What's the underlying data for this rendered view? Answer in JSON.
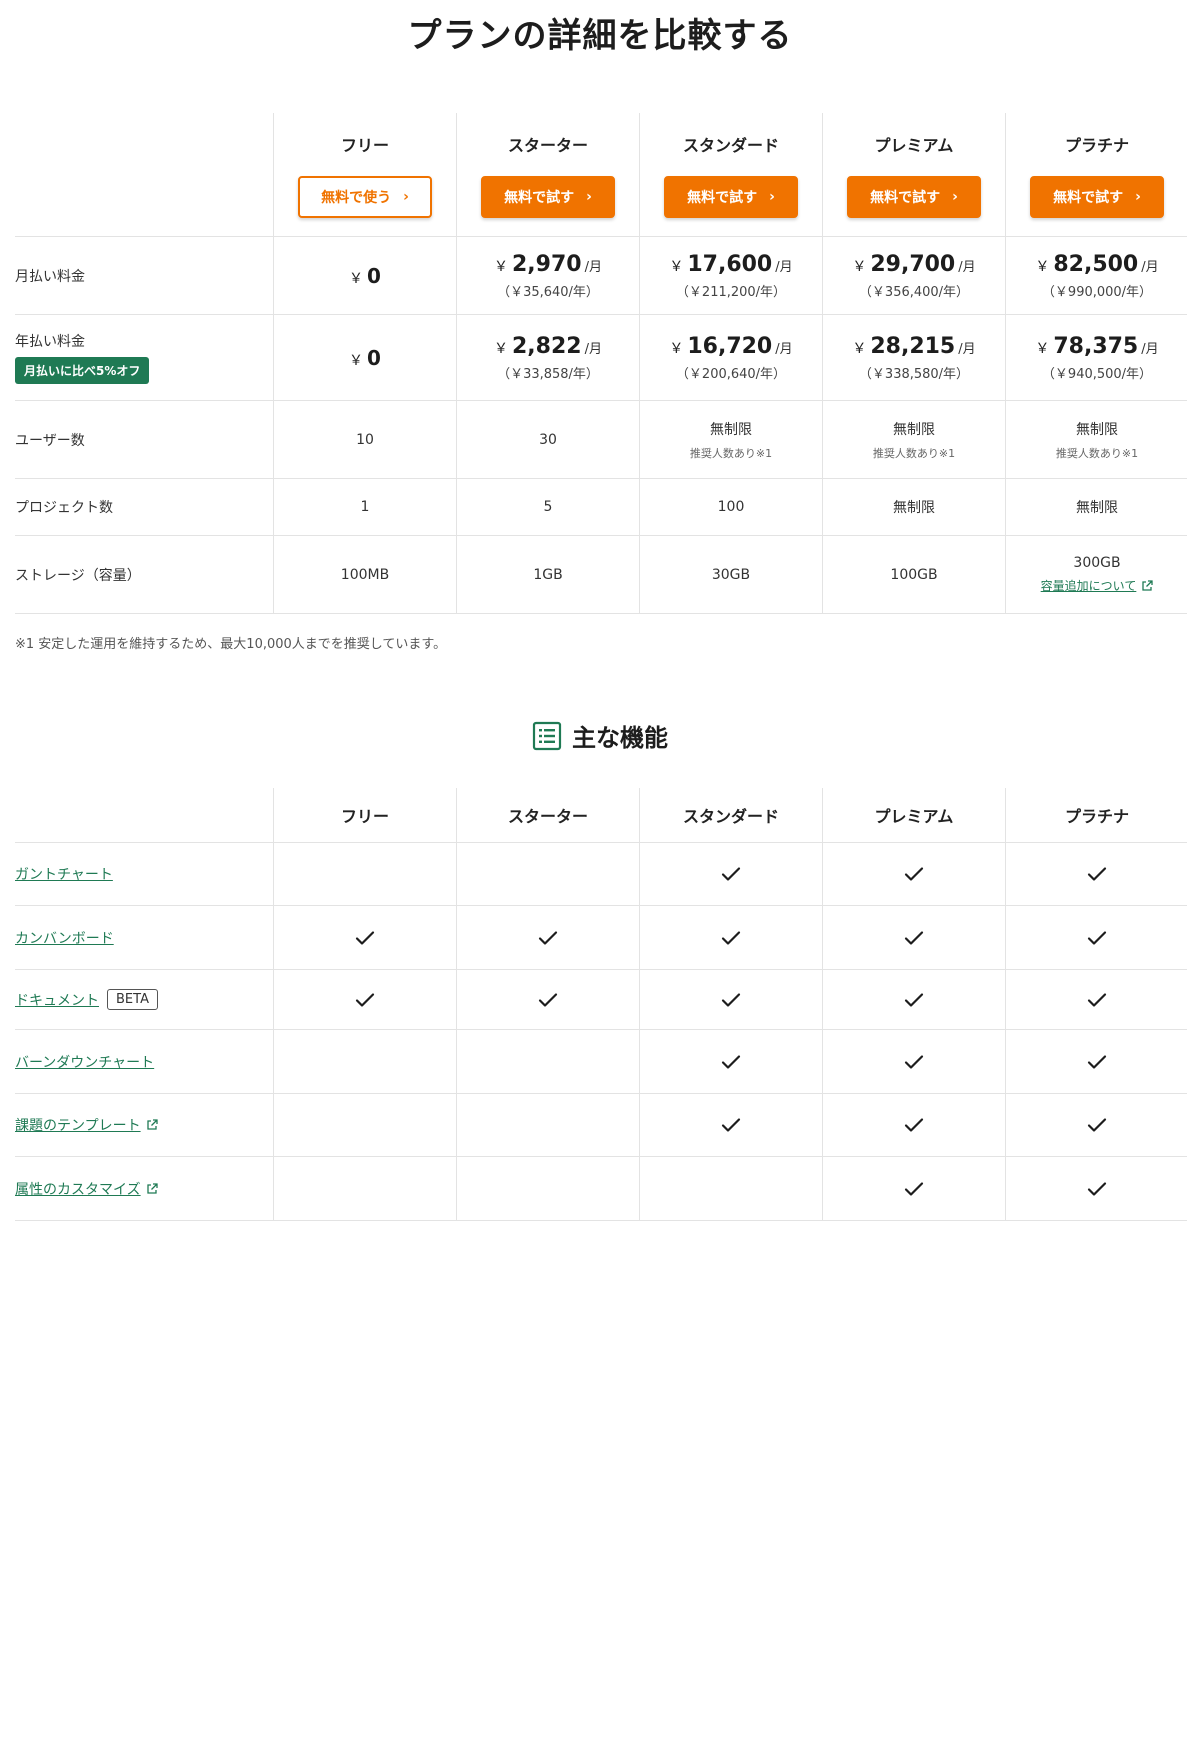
{
  "title": "プランの詳細を比較する",
  "plans": [
    {
      "name": "フリー",
      "cta": "無料で使う",
      "cta_style": "outline"
    },
    {
      "name": "スターター",
      "cta": "無料で試す",
      "cta_style": "filled"
    },
    {
      "name": "スタンダード",
      "cta": "無料で試す",
      "cta_style": "filled"
    },
    {
      "name": "プレミアム",
      "cta": "無料で試す",
      "cta_style": "filled"
    },
    {
      "name": "プラチナ",
      "cta": "無料で試す",
      "cta_style": "filled"
    }
  ],
  "currency": "￥",
  "per_month": "/月",
  "monthly": {
    "label": "月払い料金",
    "prices": [
      {
        "amount": "0",
        "yearly": ""
      },
      {
        "amount": "2,970",
        "yearly": "（￥35,640/年）"
      },
      {
        "amount": "17,600",
        "yearly": "（￥211,200/年）"
      },
      {
        "amount": "29,700",
        "yearly": "（￥356,400/年）"
      },
      {
        "amount": "82,500",
        "yearly": "（￥990,000/年）"
      }
    ]
  },
  "annual": {
    "label": "年払い料金",
    "badge": "月払いに比べ5%オフ",
    "prices": [
      {
        "amount": "0",
        "yearly": ""
      },
      {
        "amount": "2,822",
        "yearly": "（￥33,858/年）"
      },
      {
        "amount": "16,720",
        "yearly": "（￥200,640/年）"
      },
      {
        "amount": "28,215",
        "yearly": "（￥338,580/年）"
      },
      {
        "amount": "78,375",
        "yearly": "（￥940,500/年）"
      }
    ]
  },
  "users": {
    "label": "ユーザー数",
    "values": [
      {
        "value": "10",
        "note": ""
      },
      {
        "value": "30",
        "note": ""
      },
      {
        "value": "無制限",
        "note": "推奨人数あり※1"
      },
      {
        "value": "無制限",
        "note": "推奨人数あり※1"
      },
      {
        "value": "無制限",
        "note": "推奨人数あり※1"
      }
    ]
  },
  "projects": {
    "label": "プロジェクト数",
    "values": [
      "1",
      "5",
      "100",
      "無制限",
      "無制限"
    ]
  },
  "storage": {
    "label": "ストレージ（容量）",
    "values": [
      "100MB",
      "1GB",
      "30GB",
      "100GB",
      "300GB"
    ],
    "platinum_link": "容量追加について"
  },
  "footnote": "※1 安定した運用を維持するため、最大10,000人までを推奨しています。",
  "features_title": "主な機能",
  "icons": {
    "list": "list-icon",
    "check": "check-icon",
    "external": "external-link-icon",
    "chevron": "chevron-right-icon"
  },
  "colors": {
    "accent": "#f07300",
    "brand_green": "#1f7a54"
  },
  "features": [
    {
      "name": "ガントチャート",
      "badge": "",
      "external": false,
      "available": [
        false,
        false,
        true,
        true,
        true
      ]
    },
    {
      "name": "カンバンボード",
      "badge": "",
      "external": false,
      "available": [
        true,
        true,
        true,
        true,
        true
      ]
    },
    {
      "name": "ドキュメント",
      "badge": "BETA",
      "external": false,
      "available": [
        true,
        true,
        true,
        true,
        true
      ]
    },
    {
      "name": "バーンダウンチャート",
      "badge": "",
      "external": false,
      "available": [
        false,
        false,
        true,
        true,
        true
      ]
    },
    {
      "name": "課題のテンプレート",
      "badge": "",
      "external": true,
      "available": [
        false,
        false,
        true,
        true,
        true
      ]
    },
    {
      "name": "属性のカスタマイズ",
      "badge": "",
      "external": true,
      "available": [
        false,
        false,
        false,
        true,
        true
      ]
    }
  ]
}
